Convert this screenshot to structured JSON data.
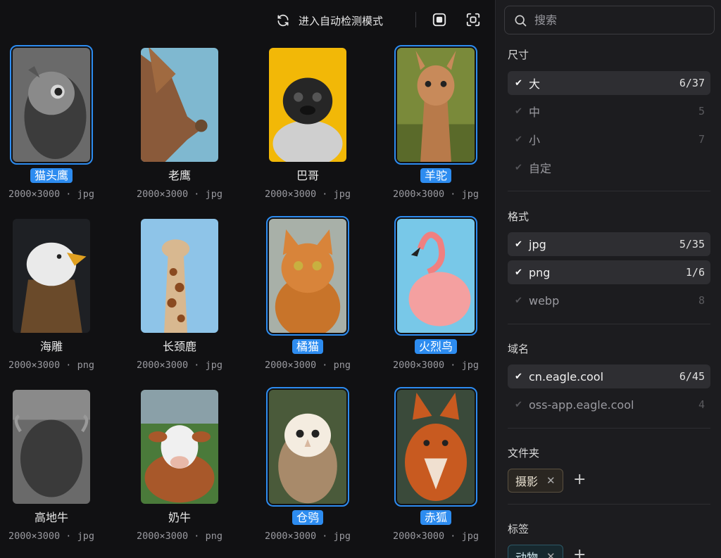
{
  "toolbar": {
    "auto_detect_label": "进入自动检测模式",
    "refresh_icon": "refresh-icon",
    "stop_icon": "stop-icon",
    "screenshot_icon": "screenshot-icon"
  },
  "cards": [
    {
      "title": "猫头鹰",
      "meta": "2000×3000 · jpg",
      "selected": true,
      "image": "owl"
    },
    {
      "title": "老鹰",
      "meta": "2000×3000 · jpg",
      "selected": false,
      "image": "hawk"
    },
    {
      "title": "巴哥",
      "meta": "2000×3000 · jpg",
      "selected": false,
      "image": "pug"
    },
    {
      "title": "羊驼",
      "meta": "2000×3000 · jpg",
      "selected": true,
      "image": "alpaca"
    },
    {
      "title": "海雕",
      "meta": "2000×3000 · png",
      "selected": false,
      "image": "eagle"
    },
    {
      "title": "长颈鹿",
      "meta": "2000×3000 · jpg",
      "selected": false,
      "image": "giraffe"
    },
    {
      "title": "橘猫",
      "meta": "2000×3000 · png",
      "selected": true,
      "image": "cat"
    },
    {
      "title": "火烈鸟",
      "meta": "2000×3000 · jpg",
      "selected": true,
      "image": "flamingo"
    },
    {
      "title": "高地牛",
      "meta": "2000×3000 · jpg",
      "selected": false,
      "image": "highland"
    },
    {
      "title": "奶牛",
      "meta": "2000×3000 · png",
      "selected": false,
      "image": "cow"
    },
    {
      "title": "仓鸮",
      "meta": "2000×3000 · jpg",
      "selected": true,
      "image": "barnowl"
    },
    {
      "title": "赤狐",
      "meta": "2000×3000 · jpg",
      "selected": true,
      "image": "fox"
    }
  ],
  "sidebar": {
    "search_placeholder": "搜索",
    "size": {
      "title": "尺寸",
      "options": [
        {
          "label": "大",
          "count": "6/37",
          "active": true
        },
        {
          "label": "中",
          "count": "5",
          "active": false
        },
        {
          "label": "小",
          "count": "7",
          "active": false
        },
        {
          "label": "自定",
          "count": "",
          "active": false
        }
      ]
    },
    "format": {
      "title": "格式",
      "options": [
        {
          "label": "jpg",
          "count": "5/35",
          "active": true
        },
        {
          "label": "png",
          "count": "1/6",
          "active": true
        },
        {
          "label": "webp",
          "count": "8",
          "active": false
        }
      ]
    },
    "domain": {
      "title": "域名",
      "options": [
        {
          "label": "cn.eagle.cool",
          "count": "6/45",
          "active": true
        },
        {
          "label": "oss-app.eagle.cool",
          "count": "4",
          "active": false
        }
      ]
    },
    "folder": {
      "title": "文件夹",
      "tag": "摄影"
    },
    "tags": {
      "title": "标签",
      "tag": "动物"
    }
  },
  "colors": {
    "accent": "#2d8cf0",
    "background": "#111113",
    "sidebar": "#1c1c1f"
  }
}
